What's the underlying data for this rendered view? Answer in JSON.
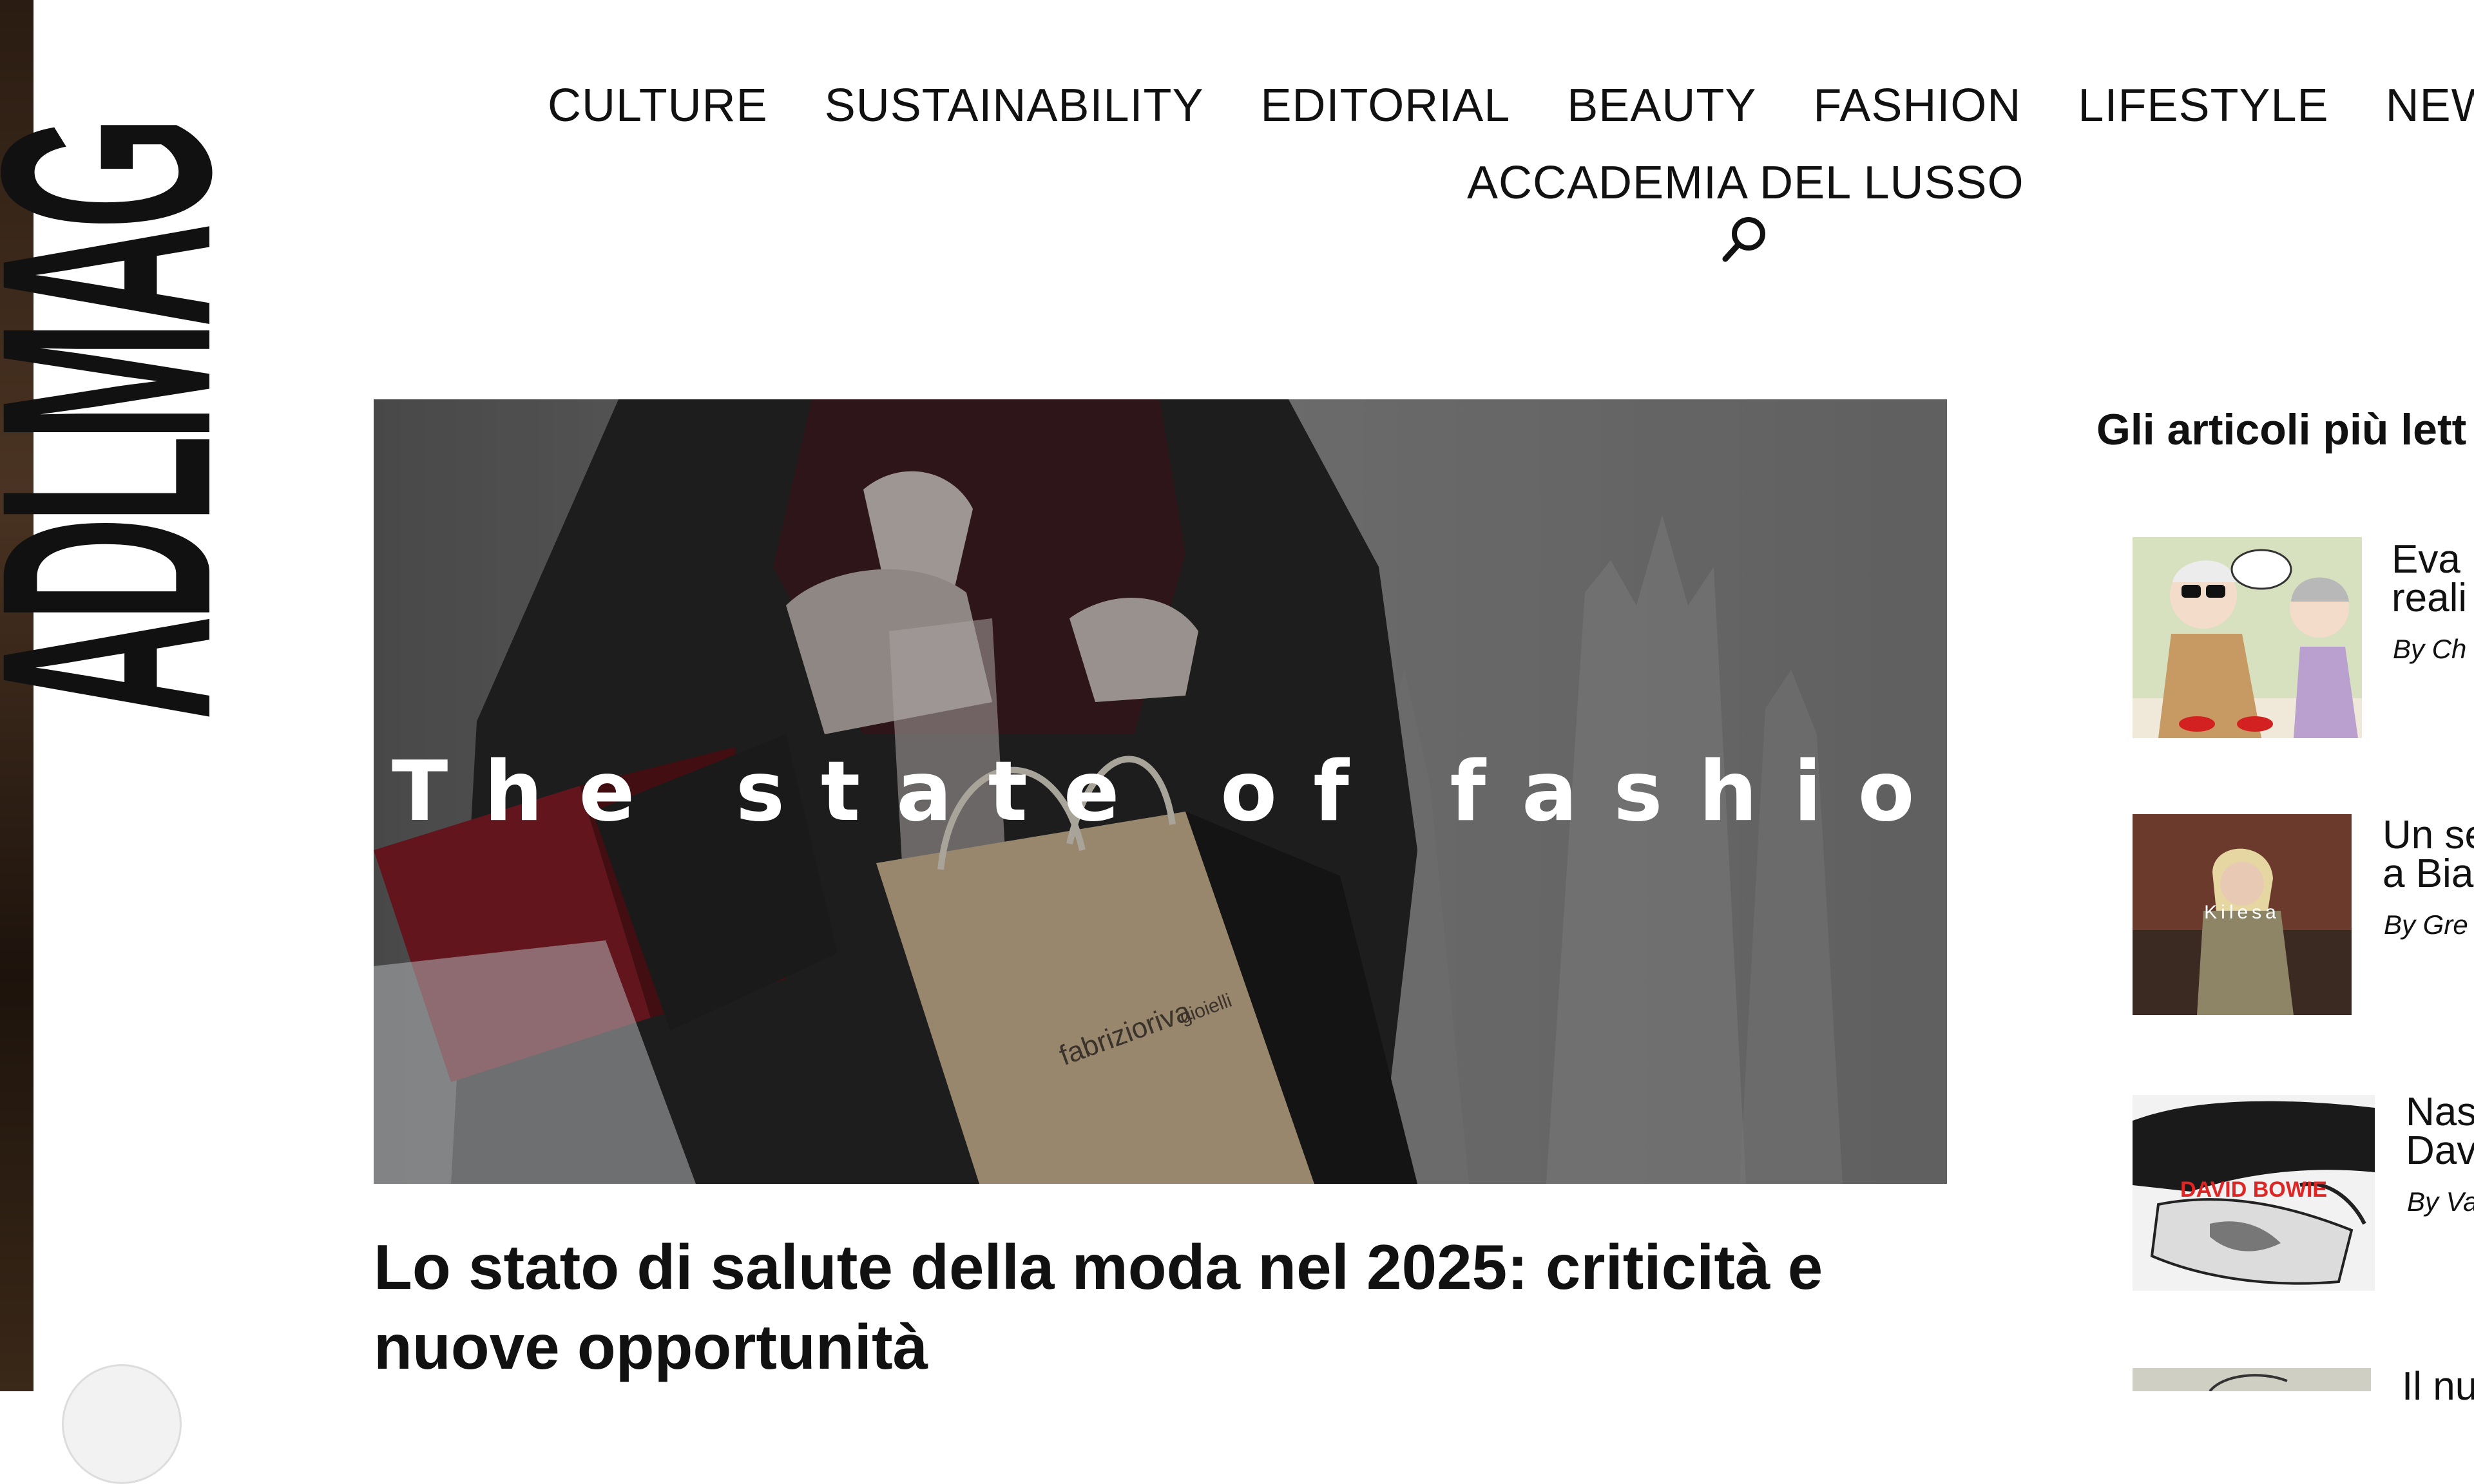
{
  "brand": {
    "logo_text": "ADLMAG"
  },
  "nav": {
    "items": [
      "CULTURE",
      "SUSTAINABILITY",
      "EDITORIAL",
      "BEAUTY",
      "FASHION",
      "LIFESTYLE",
      "NEW D"
    ],
    "row2": "ACCADEMIA DEL LUSSO",
    "search_icon": "search-icon"
  },
  "hero": {
    "overlay_title": "The state of fashion",
    "bag_brand": "fabrizioriva",
    "bag_brand_sub": "gioielli"
  },
  "article": {
    "title": "Lo stato di salute della moda nel 2025: criticità e nuove opportunità"
  },
  "sidebar": {
    "title": "Gli articoli più lett",
    "items": [
      {
        "title_line1": "Eva",
        "title_line2": "reali",
        "byline": "By Ch"
      },
      {
        "title_line1": "Un se",
        "title_line2": "a Bia",
        "byline": "By Gre",
        "thumb_label": "Kilesa"
      },
      {
        "title_line1": "Nas",
        "title_line2": "Dav",
        "byline": "By Va",
        "thumb_label": "DAVID BOWIE"
      },
      {
        "title_line1": "Il nu"
      }
    ]
  }
}
